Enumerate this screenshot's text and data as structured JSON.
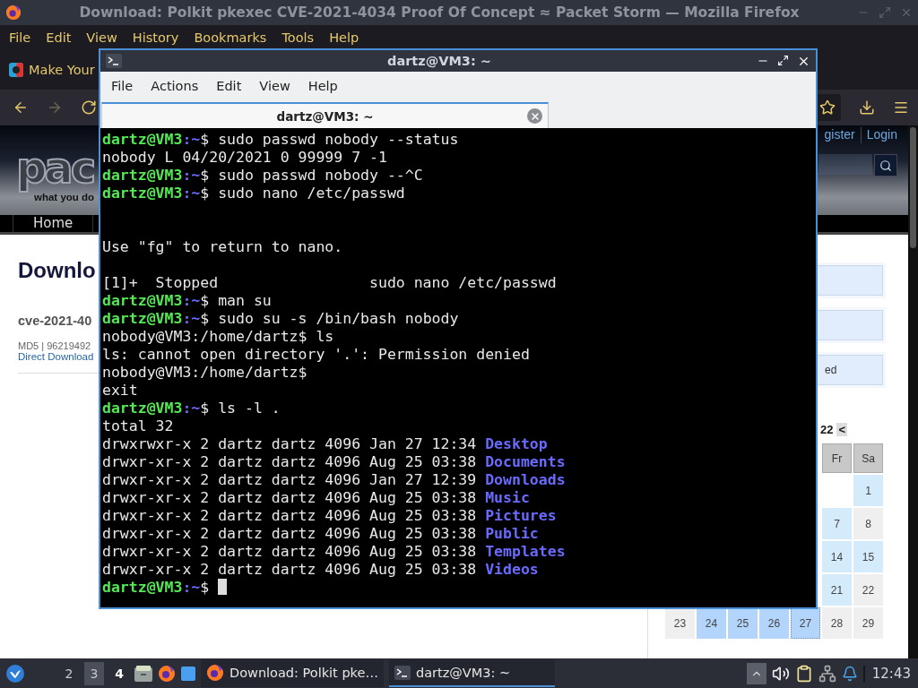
{
  "browser": {
    "title": "Download: Polkit pkexec CVE-2021-4034 Proof Of Concept ≈ Packet Storm — Mozilla Firefox",
    "menu": [
      "File",
      "Edit",
      "View",
      "History",
      "Bookmarks",
      "Tools",
      "Help"
    ],
    "tab": {
      "label": "Make Your"
    },
    "page": {
      "header": {
        "logo": "pac",
        "tagline": "what you do",
        "links": [
          "gister",
          "Login"
        ]
      },
      "nav": [
        "Home"
      ],
      "heading": "Downlo",
      "file_title": "cve-2021-40",
      "md5": "MD5 | 96219492",
      "link": "Direct Download",
      "panels": [
        {
          "kind": "empty"
        },
        {
          "kind": "empty"
        },
        {
          "kind": "text",
          "text": "ed"
        }
      ],
      "calendar": {
        "title": "22",
        "prev": "<",
        "headers": [
          "Fr",
          "Sa"
        ],
        "rows": [
          [
            "",
            {
              "text": "1",
              "color": "#d4ebfb",
              "today": false
            }
          ],
          [
            {
              "text": "7",
              "color": "#d4ebfb",
              "today": false
            },
            {
              "text": "8",
              "color": "#efefef",
              "today": false
            }
          ],
          [
            {
              "text": "14",
              "color": "#d4ebfb",
              "today": false
            },
            {
              "text": "15",
              "color": "#d4ebfb",
              "today": false
            }
          ],
          [
            {
              "text": "21",
              "color": "#d4ebfb",
              "today": false
            },
            {
              "text": "22",
              "color": "#efefef",
              "today": false
            }
          ],
          [
            {
              "text": "23",
              "color": "#efefef",
              "today": false
            },
            {
              "text": "24",
              "color": "#b3d5fb",
              "today": false
            },
            {
              "text": "25",
              "color": "#b3d5fb",
              "today": false
            },
            {
              "text": "26",
              "color": "#b3d5fb",
              "today": false
            },
            {
              "text": "27",
              "color": "#b3d5fb",
              "today": true
            },
            {
              "text": "28",
              "color": "#efefef",
              "today": false
            },
            {
              "text": "29",
              "color": "#efefef",
              "today": false
            }
          ]
        ]
      }
    }
  },
  "terminal": {
    "title": "dartz@VM3: ~",
    "menu": [
      "File",
      "Actions",
      "Edit",
      "View",
      "Help"
    ],
    "tab": "dartz@VM3: ~",
    "lines": [
      {
        "kind": "prompt",
        "user": "dartz@VM3",
        "path": ":~",
        "text": "$ sudo passwd nobody --status"
      },
      {
        "kind": "output",
        "text": "nobody L 04/20/2021 0 99999 7 -1"
      },
      {
        "kind": "prompt",
        "user": "dartz@VM3",
        "path": ":~",
        "text": "$ sudo passwd nobody --^C"
      },
      {
        "kind": "prompt",
        "user": "dartz@VM3",
        "path": ":~",
        "text": "$ sudo nano /etc/passwd"
      },
      {
        "kind": "blank"
      },
      {
        "kind": "blank"
      },
      {
        "kind": "output",
        "text": "Use \"fg\" to return to nano."
      },
      {
        "kind": "blank"
      },
      {
        "kind": "output",
        "text": "[1]+  Stopped                 sudo nano /etc/passwd"
      },
      {
        "kind": "prompt",
        "user": "dartz@VM3",
        "path": ":~",
        "text": "$ man su"
      },
      {
        "kind": "prompt",
        "user": "dartz@VM3",
        "path": ":~",
        "text": "$ sudo su -s /bin/bash nobody"
      },
      {
        "kind": "output",
        "text": "nobody@VM3:/home/dartz$ ls"
      },
      {
        "kind": "output",
        "text": "ls: cannot open directory '.': Permission denied"
      },
      {
        "kind": "output",
        "text": "nobody@VM3:/home/dartz$"
      },
      {
        "kind": "output",
        "text": "exit"
      },
      {
        "kind": "prompt",
        "user": "dartz@VM3",
        "path": ":~",
        "text": "$ ls -l ."
      },
      {
        "kind": "output",
        "text": "total 32"
      },
      {
        "kind": "dir",
        "text": "drwxrwxr-x 2 dartz dartz 4096 Jan 27 12:34 ",
        "dir": "Desktop"
      },
      {
        "kind": "dir",
        "text": "drwxr-xr-x 2 dartz dartz 4096 Aug 25 03:38 ",
        "dir": "Documents"
      },
      {
        "kind": "dir",
        "text": "drwxr-xr-x 2 dartz dartz 4096 Jan 27 12:39 ",
        "dir": "Downloads"
      },
      {
        "kind": "dir",
        "text": "drwxr-xr-x 2 dartz dartz 4096 Aug 25 03:38 ",
        "dir": "Music"
      },
      {
        "kind": "dir",
        "text": "drwxr-xr-x 2 dartz dartz 4096 Aug 25 03:38 ",
        "dir": "Pictures"
      },
      {
        "kind": "dir",
        "text": "drwxr-xr-x 2 dartz dartz 4096 Aug 25 03:38 ",
        "dir": "Public"
      },
      {
        "kind": "dir",
        "text": "drwxr-xr-x 2 dartz dartz 4096 Aug 25 03:38 ",
        "dir": "Templates"
      },
      {
        "kind": "dir",
        "text": "drwxr-xr-x 2 dartz dartz 4096 Aug 25 03:38 ",
        "dir": "Videos"
      },
      {
        "kind": "prompt",
        "user": "dartz@VM3",
        "path": ":~",
        "text": "$ ",
        "cursor": true
      }
    ]
  },
  "taskbar": {
    "desktops": [
      {
        "label": "2",
        "selected": false,
        "occupied": false
      },
      {
        "label": "3",
        "selected": true,
        "occupied": false
      },
      {
        "label": "4",
        "selected": false,
        "occupied": true
      }
    ],
    "tasks": [
      {
        "kind": "browser",
        "label": "Download: Polkit pke…",
        "selected": false
      },
      {
        "kind": "terminal",
        "label": "dartz@VM3: ~",
        "selected": true
      }
    ],
    "clock": "12:43"
  }
}
